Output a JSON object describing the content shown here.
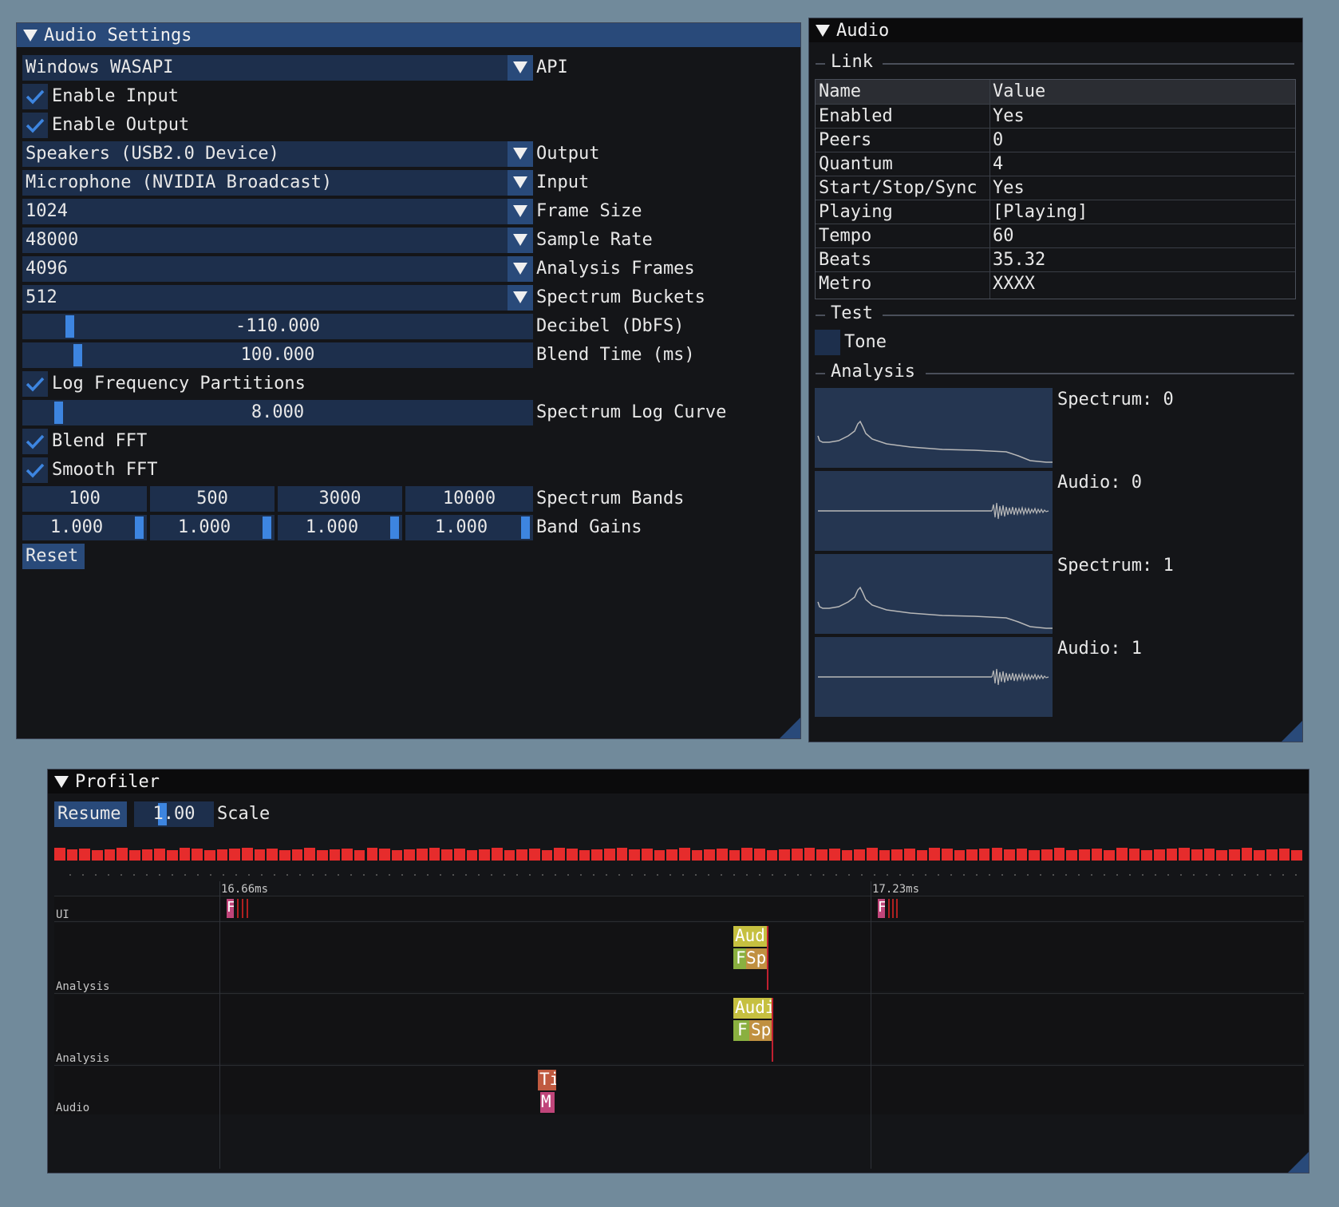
{
  "audio_settings": {
    "title": "Audio Settings",
    "api": {
      "value": "Windows WASAPI",
      "label": "API"
    },
    "enable_input": {
      "checked": true,
      "label": "Enable Input"
    },
    "enable_output": {
      "checked": true,
      "label": "Enable Output"
    },
    "output": {
      "value": "Speakers (USB2.0 Device)",
      "label": "Output"
    },
    "input": {
      "value": "Microphone (NVIDIA Broadcast)",
      "label": "Input"
    },
    "frame_size": {
      "value": "1024",
      "label": "Frame Size"
    },
    "sample_rate": {
      "value": "48000",
      "label": "Sample Rate"
    },
    "analysis_frames": {
      "value": "4096",
      "label": "Analysis Frames"
    },
    "spectrum_buckets": {
      "value": "512",
      "label": "Spectrum Buckets"
    },
    "decibel": {
      "value": "-110.000",
      "label": "Decibel (DbFS)"
    },
    "blend_time": {
      "value": "100.000",
      "label": "Blend Time (ms)"
    },
    "log_freq": {
      "checked": true,
      "label": "Log Frequency Partitions"
    },
    "log_curve": {
      "value": "8.000",
      "label": "Spectrum Log Curve"
    },
    "blend_fft": {
      "checked": true,
      "label": "Blend FFT"
    },
    "smooth_fft": {
      "checked": true,
      "label": "Smooth FFT"
    },
    "bands": {
      "values": [
        "100",
        "500",
        "3000",
        "10000"
      ],
      "label": "Spectrum Bands"
    },
    "gains": {
      "values": [
        "1.000",
        "1.000",
        "1.000",
        "1.000"
      ],
      "label": "Band Gains"
    },
    "reset_label": "Reset"
  },
  "audio": {
    "title": "Audio",
    "link_header": "Link",
    "table_headers": [
      "Name",
      "Value"
    ],
    "table_rows": [
      [
        "Enabled",
        "Yes"
      ],
      [
        "Peers",
        "0"
      ],
      [
        "Quantum",
        "4"
      ],
      [
        "Start/Stop/Sync",
        "Yes"
      ],
      [
        "Playing",
        "[Playing]"
      ],
      [
        "Tempo",
        "60"
      ],
      [
        "Beats",
        "35.32"
      ],
      [
        "Metro",
        "XXXX"
      ]
    ],
    "test_header": "Test",
    "tone_label": "Tone",
    "analysis_header": "Analysis",
    "plots": [
      "Spectrum: 0",
      "Audio: 0",
      "Spectrum: 1",
      "Audio: 1"
    ]
  },
  "profiler": {
    "title": "Profiler",
    "resume_label": "Resume",
    "scale_value": "1.00",
    "scale_label": "Scale",
    "time_markers": [
      "16.66ms",
      "17.23ms"
    ],
    "lanes": [
      "UI",
      "Analysis",
      "Analysis",
      "Audio"
    ],
    "blocks": {
      "analysis1_top": "Aud",
      "analysis1_f": "F",
      "analysis1_sp": "Sp",
      "analysis2_top": "Audi",
      "analysis2_f": "F",
      "analysis2_sp": "Sp",
      "audio_top": "Ti",
      "audio_m": "M",
      "ui1": "F",
      "ui2": "F"
    }
  },
  "colors": {
    "background": "#718a9b",
    "window": "#141518",
    "title_active": "#294a7a",
    "frame": "#1d2f4c",
    "accent": "#3d85e0",
    "frame_bar": "#e62c2c"
  }
}
